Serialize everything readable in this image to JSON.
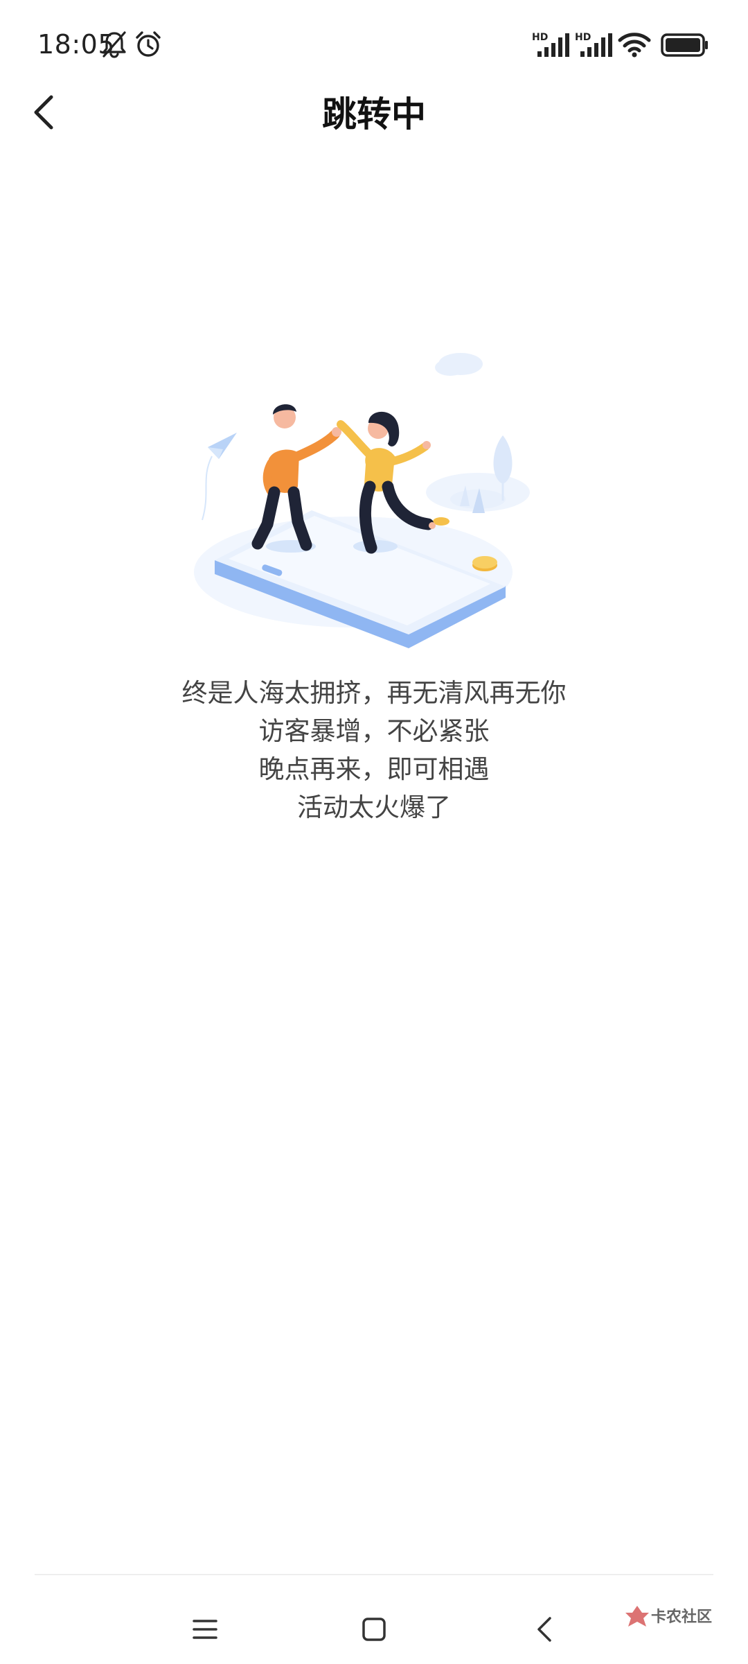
{
  "status_bar": {
    "time": "18:05",
    "icons": [
      "bell-off-icon",
      "alarm-icon",
      "hd-signal-icon",
      "hd-signal-icon",
      "wifi-icon",
      "battery-icon"
    ],
    "hd_label": "HD"
  },
  "nav": {
    "title": "跳转中",
    "back_icon": "chevron-left-icon"
  },
  "illustration": {
    "accent_blue": "#8FB6F2",
    "accent_orange": "#F2913A",
    "accent_yellow": "#F5C04A"
  },
  "message": {
    "lines": [
      "终是人海太拥挤，再无清风再无你",
      "访客暴增，不必紧张",
      "晚点再来，即可相遇",
      "活动太火爆了"
    ]
  },
  "system_nav": {
    "icons": [
      "menu-icon",
      "home-square-icon",
      "back-triangle-icon"
    ]
  },
  "watermark": {
    "text": "卡农社区"
  }
}
